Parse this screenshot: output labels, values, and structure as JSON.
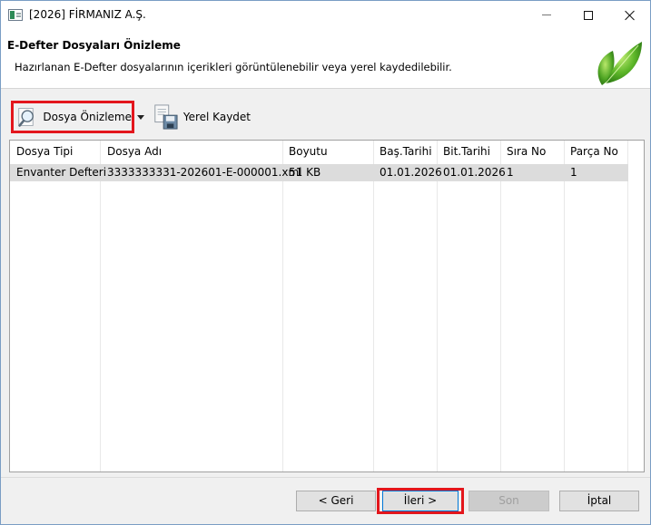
{
  "window": {
    "title": "[2026] FİRMANIZ A.Ş."
  },
  "header": {
    "title": "E-Defter Dosyaları Önizleme",
    "subtitle": "Hazırlanan E-Defter dosyalarının içerikleri görüntülenebilir veya yerel kaydedilebilir."
  },
  "toolbar": {
    "preview_label": "Dosya Önizleme",
    "save_label": "Yerel Kaydet"
  },
  "grid": {
    "columns": [
      "Dosya Tipi",
      "Dosya Adı",
      "Boyutu",
      "Baş.Tarihi",
      "Bit.Tarihi",
      "Sıra No",
      "Parça No"
    ],
    "rows": [
      [
        "Envanter Defteri",
        "3333333331-202601-E-000001.xml",
        "51 KB",
        "01.01.2026",
        "01.01.2026",
        "1",
        "1"
      ]
    ]
  },
  "footer": {
    "back_label": "< Geri",
    "next_label": "İleri >",
    "finish_label": "Son",
    "cancel_label": "İptal"
  },
  "colors": {
    "highlight": "#e3161c",
    "selected_row": "#dcdcdc",
    "accent_border": "#0078d7"
  }
}
